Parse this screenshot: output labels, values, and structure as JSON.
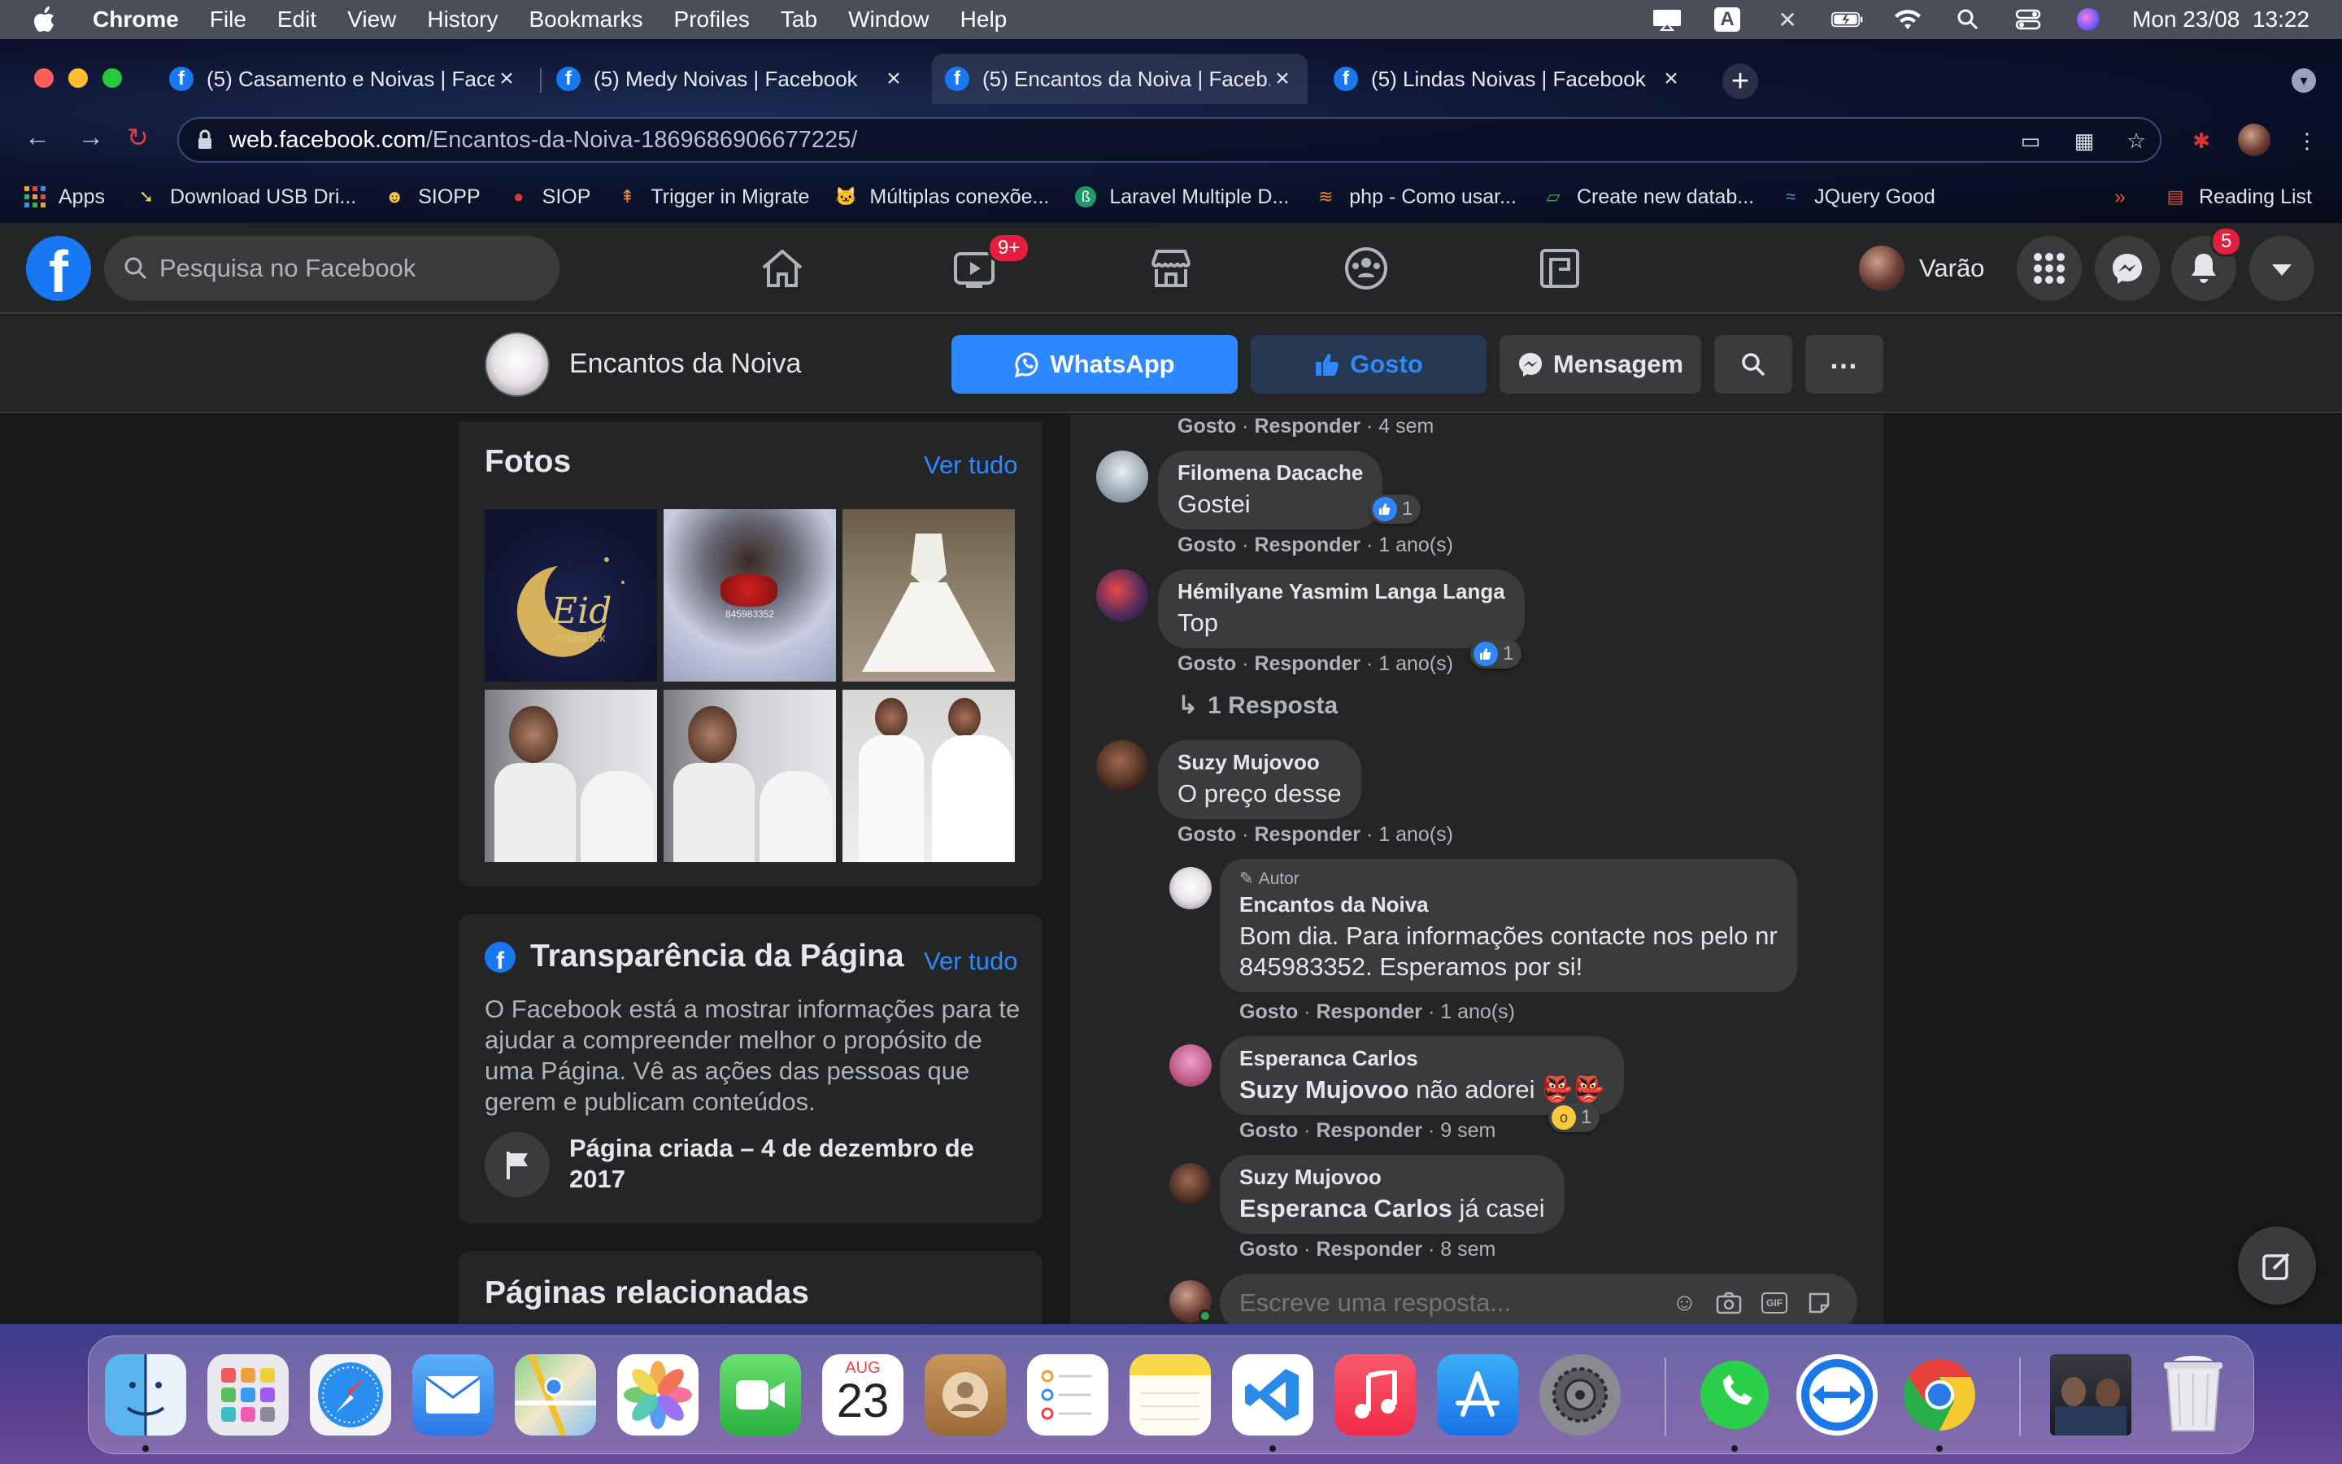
{
  "menubar": {
    "items": [
      "Chrome",
      "File",
      "Edit",
      "View",
      "History",
      "Bookmarks",
      "Profiles",
      "Tab",
      "Window",
      "Help"
    ],
    "clock": "Mon 23/08  13:22",
    "input_source": "A"
  },
  "browser": {
    "tabs": [
      {
        "title": "(5) Casamento e Noivas | Face..."
      },
      {
        "title": "(5) Medy Noivas | Facebook"
      },
      {
        "title": "(5) Encantos da Noiva | Faceb..."
      },
      {
        "title": "(5) Lindas Noivas | Facebook"
      }
    ],
    "url_host": "web.facebook.com",
    "url_path": "/Encantos-da-Noiva-1869686906677225/",
    "bookmarks": [
      {
        "label": "Apps",
        "icon": "apps-grid-icon"
      },
      {
        "label": "Download USB Dri...",
        "icon": "download-icon"
      },
      {
        "label": "SIOPP",
        "icon": "siopp-icon"
      },
      {
        "label": "SIOP",
        "icon": "siop-icon"
      },
      {
        "label": "Trigger in Migrate",
        "icon": "trigger-icon"
      },
      {
        "label": "Múltiplas conexõe...",
        "icon": "cat-icon"
      },
      {
        "label": "Laravel Multiple D...",
        "icon": "laravel-icon"
      },
      {
        "label": "php - Como usar...",
        "icon": "stackoverflow-icon"
      },
      {
        "label": "Create new datab...",
        "icon": "database-icon"
      },
      {
        "label": "JQuery Good",
        "icon": "jquery-icon"
      }
    ],
    "reading_list": "Reading List"
  },
  "facebook": {
    "search_placeholder": "Pesquisa no Facebook",
    "video_badge": "9+",
    "profile_name": "Varão",
    "notifications_badge": "5",
    "page": {
      "name": "Encantos da Noiva",
      "whatsapp_label": "WhatsApp",
      "like_label": "Gosto",
      "message_label": "Mensagem"
    },
    "photos": {
      "title": "Fotos",
      "see_all": "Ver tudo",
      "eid_text": "Eid",
      "eid_sub": "mubarak",
      "phone_watermark": "845983352"
    },
    "transparency": {
      "title": "Transparência da Página",
      "see_all": "Ver tudo",
      "text": "O Facebook está a mostrar informações para te ajudar a compreender melhor o propósito de uma Página. Vê as ações das pessoas que gerem e publicam conteúdos.",
      "created_line1": "Página criada – 4 de dezembro de",
      "created_line2": "2017"
    },
    "related_title": "Páginas relacionadas",
    "comments": {
      "top_meta_like": "Gosto",
      "top_meta_reply": "Responder",
      "top_meta_time": "4 sem",
      "items": [
        {
          "name": "Filomena Dacache",
          "text": "Gostei",
          "like": "Gosto",
          "reply": "Responder",
          "time": "1 ano(s)",
          "reactions": "1"
        },
        {
          "name": "Hémilyane Yasmim Langa Langa",
          "text": "Top",
          "like": "Gosto",
          "reply": "Responder",
          "time": "1 ano(s)",
          "reactions": "1"
        },
        {
          "name": "Suzy Mujovoo",
          "text": "O preço desse",
          "like": "Gosto",
          "reply": "Responder",
          "time": "1 ano(s)"
        }
      ],
      "replies_link": "1 Resposta",
      "replies": [
        {
          "badge": "Autor",
          "name": "Encantos da Noiva",
          "text_line1": "Bom dia. Para informações contacte nos pelo nr",
          "text_line2": "845983352. Esperamos por si!",
          "like": "Gosto",
          "reply": "Responder",
          "time": "1 ano(s)"
        },
        {
          "name": "Esperanca Carlos",
          "mention": "Suzy Mujovoo",
          "text": " não adorei 👺👺",
          "like": "Gosto",
          "reply": "Responder",
          "time": "9 sem",
          "reactions": "1"
        },
        {
          "name": "Suzy Mujovoo",
          "mention": "Esperanca Carlos",
          "text": " já casei",
          "like": "Gosto",
          "reply": "Responder",
          "time": "8 sem"
        }
      ],
      "reply_placeholder": "Escreve uma resposta..."
    }
  },
  "dock": {
    "calendar_month": "AUG",
    "calendar_day": "23"
  },
  "colors": {
    "fb_blue": "#1877f2",
    "fb_dark_bg": "#18191a",
    "fb_card": "#242526",
    "fb_link": "#2d88ff",
    "badge_red": "#e41e3f"
  }
}
